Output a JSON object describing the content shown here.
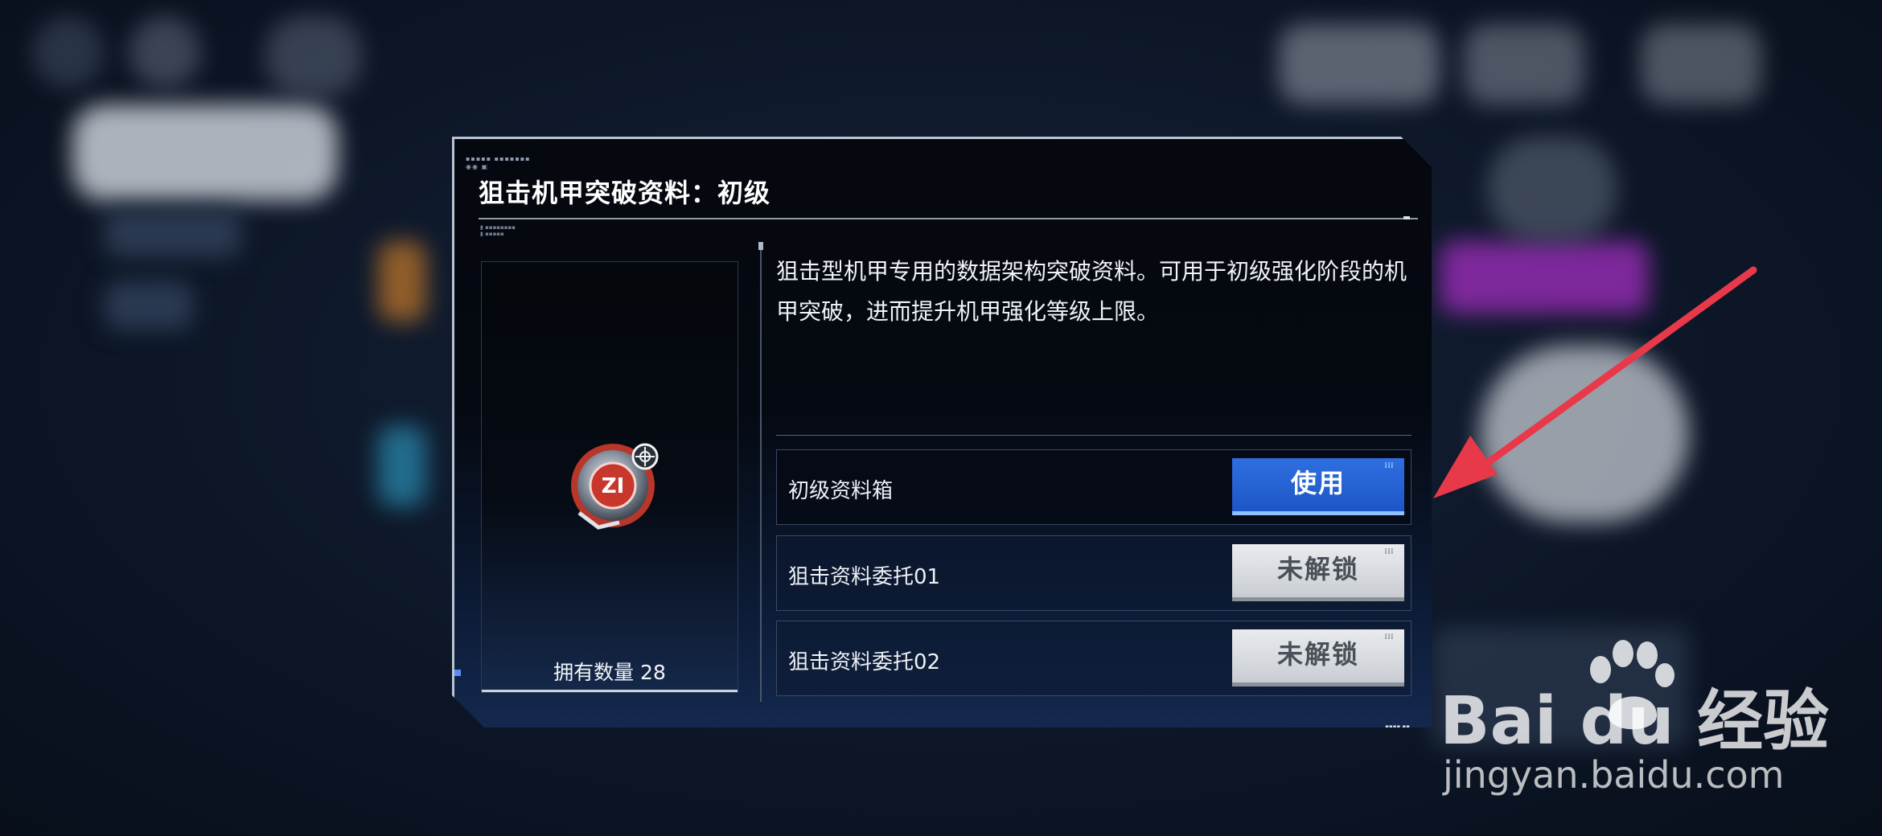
{
  "dialog": {
    "title": "狙击机甲突破资料：初级",
    "description": "狙击型机甲专用的数据架构突破资料。可用于初级强化阶段的机甲突破，进而提升机甲强化等级上限。",
    "item": {
      "icon": "breakthrough-material-icon",
      "count_label": "拥有数量 28"
    },
    "sources": [
      {
        "label": "初级资料箱",
        "button": "使用",
        "state": "available"
      },
      {
        "label": "狙击资料委托01",
        "button": "未解锁",
        "state": "locked"
      },
      {
        "label": "狙击资料委托02",
        "button": "未解锁",
        "state": "locked"
      }
    ]
  },
  "annotation": {
    "type": "arrow",
    "color": "#e8394a",
    "points_to": "use-button"
  },
  "watermark": {
    "brand": "Bai du 经验",
    "url": "jingyan.baidu.com"
  },
  "colors": {
    "primary_button": "#2563d8",
    "locked_button": "#d4d7dc",
    "panel_border": "#b9c4d3"
  }
}
